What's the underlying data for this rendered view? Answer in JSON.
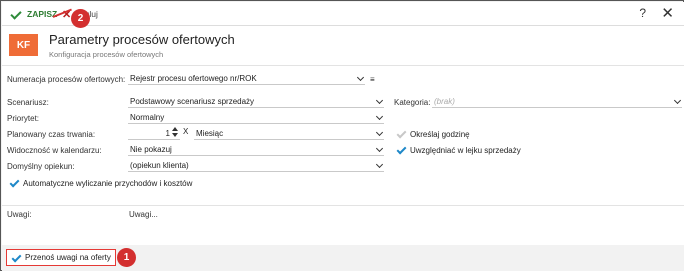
{
  "toolbar": {
    "save_label": "ZAPISZ",
    "cancel_label": "Anuluj",
    "help_label": "?",
    "close_label": "✕"
  },
  "header": {
    "logo": "KF",
    "title": "Parametry procesów ofertowych",
    "subtitle": "Konfiguracja procesów ofertowych"
  },
  "form": {
    "numbering_label": "Numeracja procesów ofertowych:",
    "numbering_value": "Rejestr procesu ofertowego nr/ROK",
    "scenario_label": "Scenariusz:",
    "scenario_value": "Podstawowy scenariusz sprzedaży",
    "priority_label": "Priorytet:",
    "priority_value": "Normalny",
    "duration_label": "Planowany czas trwania:",
    "duration_value": "1",
    "duration_unit": "Miesiąc",
    "visibility_label": "Widoczność w kalendarzu:",
    "visibility_value": "Nie pokazuj",
    "owner_label": "Domyślny opiekun:",
    "owner_value": "(opiekun klienta)",
    "auto_calc_label": "Automatyczne wyliczanie przychodów i kosztów",
    "category_label": "Kategoria:",
    "category_placeholder": "(brak)",
    "hours_label": "Określaj godzinę",
    "funnel_label": "Uwzględniać w lejku sprzedaży"
  },
  "notes": {
    "label": "Uwagi:",
    "value": "Uwagi..."
  },
  "transfer_notes_label": "Przenoś uwagi na oferty",
  "annotations": {
    "badge_1": "1",
    "badge_2": "2"
  },
  "colors": {
    "logo_bg": "#ef6c37",
    "save_green": "#2e7d32",
    "check_blue": "#1e88c8",
    "annotation_red": "#d32f2f"
  }
}
